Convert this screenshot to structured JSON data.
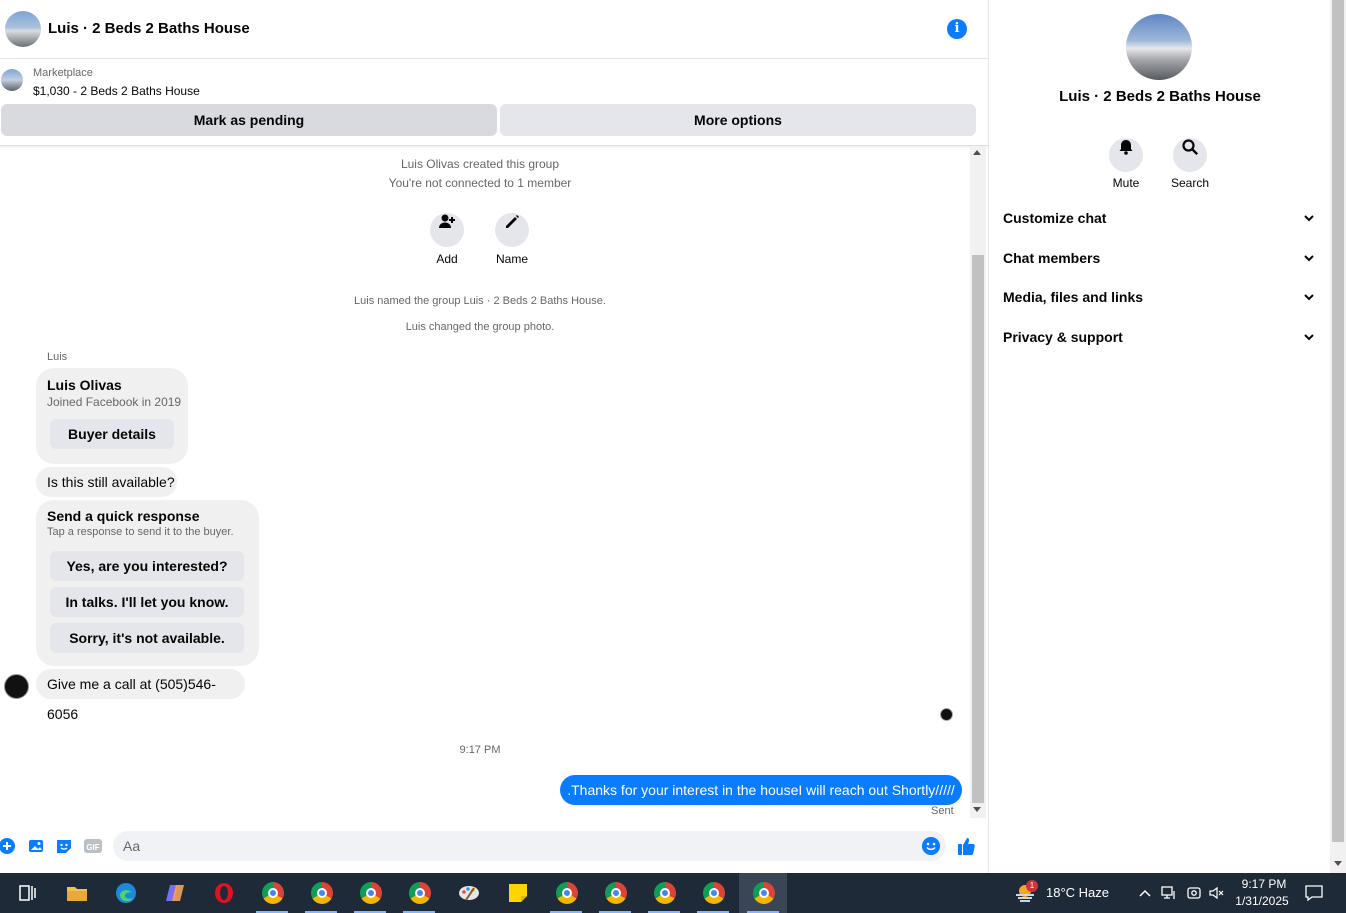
{
  "chat": {
    "title": "Luis · 2 Beds 2 Baths House",
    "marketplace_label": "Marketplace",
    "listing": "$1,030 - 2 Beds 2 Baths House",
    "mark_pending_label": "Mark as pending",
    "more_options_label": "More options"
  },
  "messages": {
    "created": "Luis Olivas created this group",
    "not_connected": "You're not connected to 1 member",
    "add_label": "Add",
    "name_label": "Name",
    "named_group": "Luis named the group Luis · 2 Beds 2 Baths House.",
    "changed_photo": "Luis changed the group photo.",
    "sender": "Luis",
    "profile_name": "Luis Olivas",
    "profile_sub": "Joined Facebook in 2019",
    "buyer_details": "Buyer details",
    "msg_available": "Is this still available?",
    "quick_title": "Send a quick response",
    "quick_sub": "Tap a response to send it to the buyer.",
    "quick_replies": [
      "Yes, are you interested?",
      "In talks. I'll let you know.",
      "Sorry, it's not available."
    ],
    "msg_call": "Give me a call at (505)546-6056",
    "timestamp": "9:17 PM",
    "sent_text": ".Thanks for your interest in the houseI will reach out Shortly/////",
    "sent_status": "Sent"
  },
  "composer": {
    "placeholder": "Aa",
    "icons": [
      "plus-icon",
      "photo-icon",
      "sticker-icon",
      "gif-icon",
      "emoji-icon",
      "thumbs-up-icon"
    ],
    "gif_label": "GIF"
  },
  "panel": {
    "title": "Luis · 2 Beds 2 Baths House",
    "mute_label": "Mute",
    "search_label": "Search",
    "sections": [
      "Customize chat",
      "Chat members",
      "Media, files and links",
      "Privacy & support"
    ]
  },
  "taskbar": {
    "apps": [
      "task-view",
      "file-explorer",
      "edge",
      "copilot",
      "opera",
      "chrome",
      "chrome",
      "chrome",
      "chrome",
      "paint",
      "sticky-notes",
      "chrome",
      "chrome",
      "chrome",
      "chrome",
      "chrome"
    ],
    "weather_badge": "1",
    "weather": "18°C  Haze",
    "time": "9:17 PM",
    "date": "1/31/2025"
  },
  "colors": {
    "accent": "#0a7cff",
    "bubble": "#f0f0f0",
    "taskbar": "#1f2a38"
  }
}
